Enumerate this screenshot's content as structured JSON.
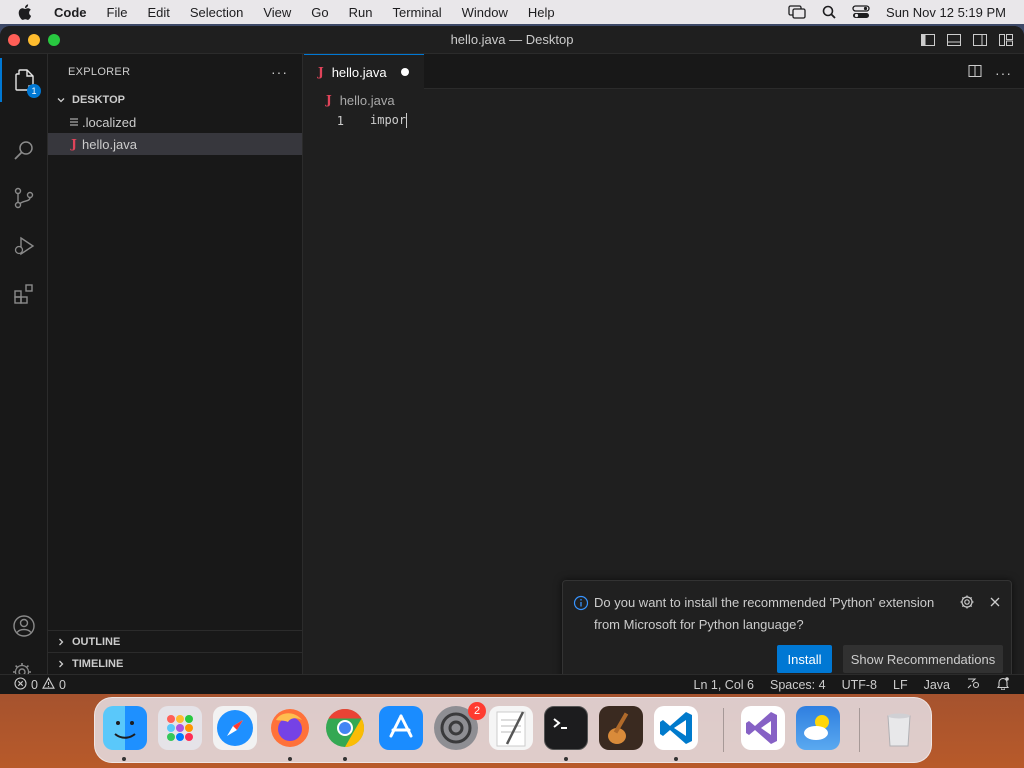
{
  "menubar": {
    "app_name": "Code",
    "items": [
      "File",
      "Edit",
      "Selection",
      "View",
      "Go",
      "Run",
      "Terminal",
      "Window",
      "Help"
    ],
    "datetime": "Sun Nov 12  5:19 PM"
  },
  "window": {
    "title": "hello.java — Desktop"
  },
  "activity": {
    "explorer_badge": "1"
  },
  "sidebar": {
    "header": "EXPLORER",
    "more": "···",
    "folder": "DESKTOP",
    "files": [
      {
        "name": ".localized",
        "icon": "lines-icon"
      },
      {
        "name": "hello.java",
        "icon": "java-icon"
      }
    ],
    "outline": "OUTLINE",
    "timeline": "TIMELINE"
  },
  "editor": {
    "tab_label": "hello.java",
    "breadcrumb": "hello.java",
    "lines": [
      {
        "number": "1",
        "text": "impor"
      }
    ]
  },
  "notification": {
    "message": "Do you want to install the recommended 'Python' extension from Microsoft for Python language?",
    "install": "Install",
    "show_recommendations": "Show Recommendations"
  },
  "statusbar": {
    "errors": "0",
    "warnings": "0",
    "position": "Ln 1, Col 6",
    "spaces": "Spaces: 4",
    "encoding": "UTF-8",
    "eol": "LF",
    "language": "Java"
  },
  "dock": {
    "apps": [
      "finder",
      "launchpad",
      "safari",
      "firefox",
      "chrome",
      "app-store",
      "system-settings",
      "textedit",
      "terminal",
      "garageband",
      "vscode",
      "visual-studio",
      "weather",
      "trash"
    ],
    "settings_badge": "2"
  },
  "colors": {
    "accent": "#0078d4",
    "java": "#e0445a"
  }
}
